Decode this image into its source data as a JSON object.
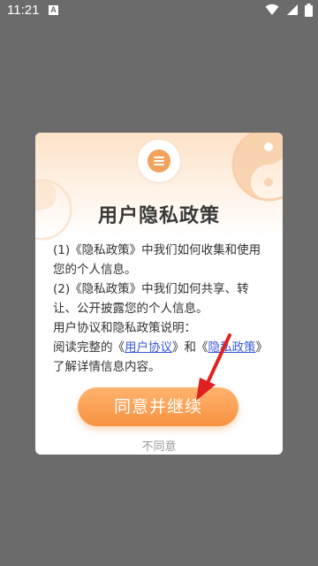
{
  "status_bar": {
    "time": "11:21",
    "notification_badge": "A",
    "icons": [
      "wifi-icon",
      "signal-icon",
      "battery-icon"
    ]
  },
  "dialog": {
    "header_icon": "menu-icon",
    "title": "用户隐私政策",
    "para1": "(1)《隐私政策》中我们如何收集和使用您的个人信息。",
    "para2": "(2)《隐私政策》中我们如何共享、转让、公开披露您的个人信息。",
    "para3_heading": "用户协议和隐私政策说明：",
    "para4_prefix": "阅读完整的《",
    "user_agreement_link": "用户协议",
    "para4_middle": "》和《",
    "privacy_policy_link": "隐私政策",
    "para4_suffix": "》了解详情信息内容。",
    "agree_button": "同意并继续",
    "disagree_button": "不同意"
  },
  "colors": {
    "accent": "#f7913f",
    "link": "#3b5bdb",
    "arrow": "#e02020",
    "overlay": "#6b6b6b"
  }
}
